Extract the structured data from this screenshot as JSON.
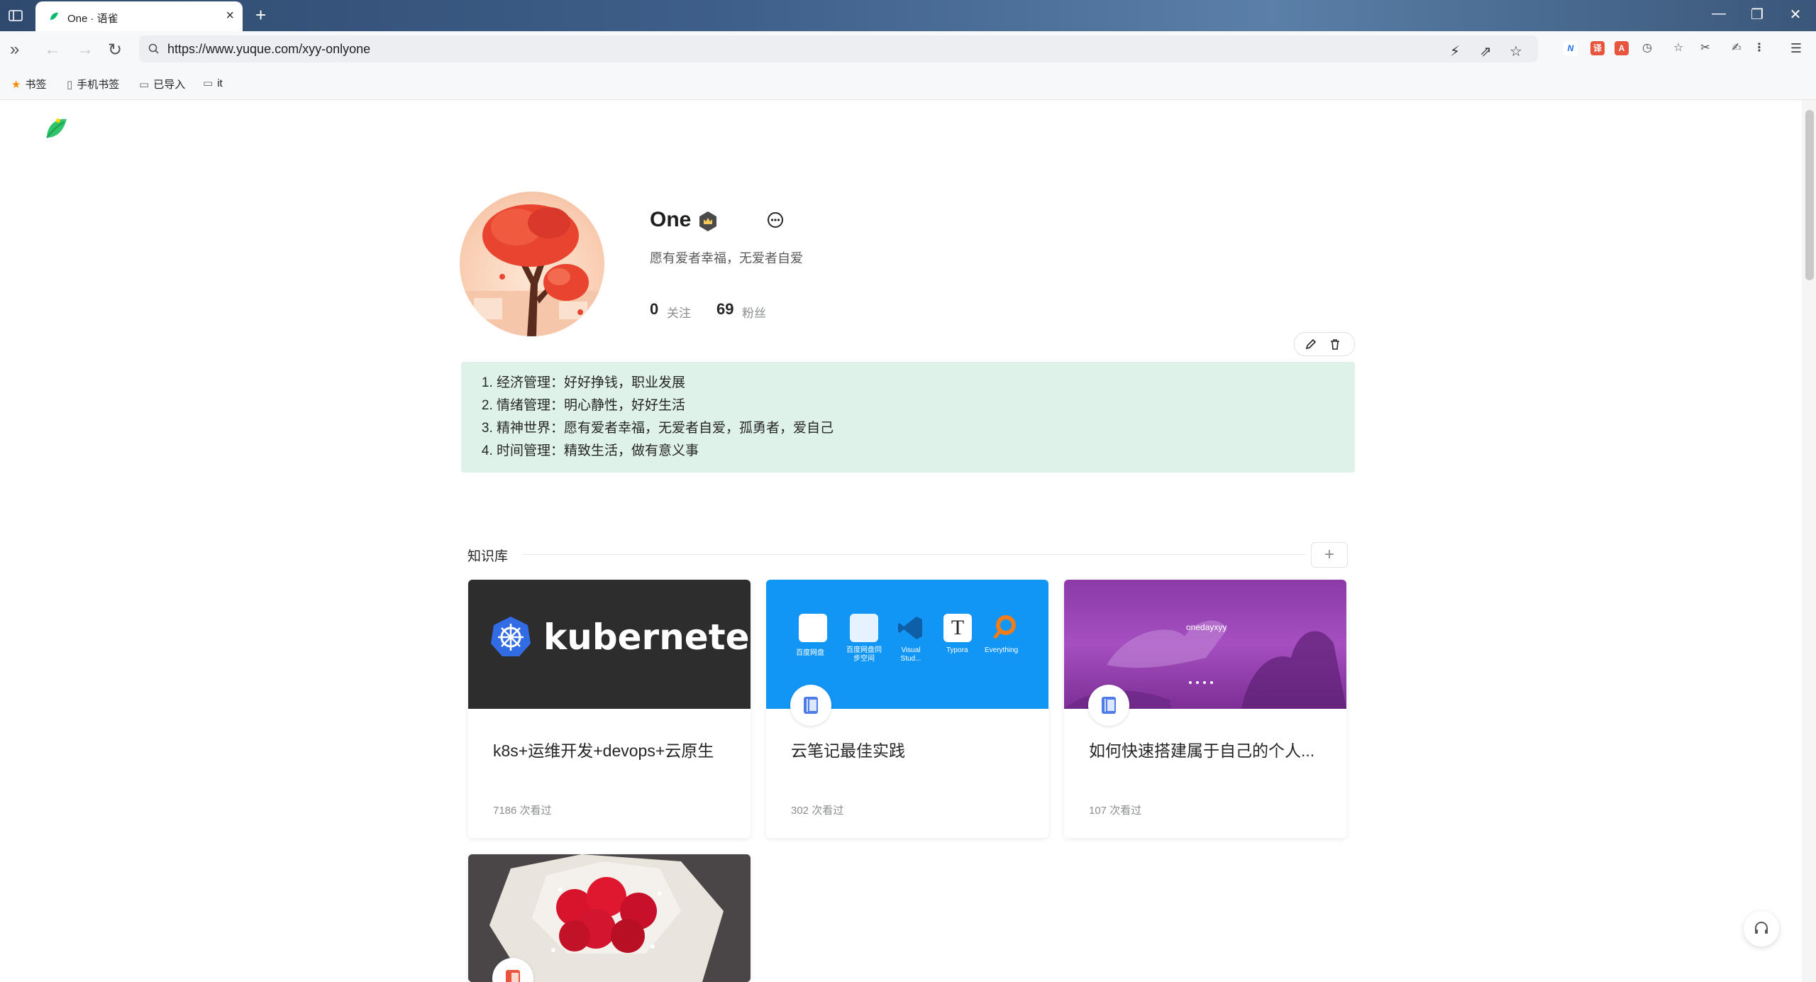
{
  "browser": {
    "tab_title": "One · 语雀",
    "tab_close": "×",
    "new_tab": "+",
    "url": "https://www.yuque.com/xyy-onlyone",
    "window_controls": {
      "minimize": "—",
      "restore": "❐",
      "close": "✕"
    },
    "bookmarks": [
      {
        "label": "书签",
        "icon": "star-icon"
      },
      {
        "label": "手机书签",
        "icon": "phone-icon"
      },
      {
        "label": "已导入",
        "icon": "folder-icon"
      },
      {
        "label": "it",
        "icon": "folder-icon"
      }
    ]
  },
  "profile": {
    "name": "One",
    "bio": "愿有爱者幸福，无爱者自爱",
    "following_count": "0",
    "following_label": "关注",
    "followers_count": "69",
    "followers_label": "粉丝"
  },
  "note": {
    "items": [
      "经济管理：好好挣钱，职业发展",
      "情绪管理：明心静性，好好生活",
      "精神世界：愿有爱者幸福，无爱者自爱，孤勇者，爱自己",
      "时间管理：精致生活，做有意义事"
    ]
  },
  "knowledge_base": {
    "section_title": "知识库",
    "add_label": "+",
    "cards": [
      {
        "title": "k8s+运维开发+devops+云原生",
        "views": "7186 次看过",
        "cover_text": "kubernetes"
      },
      {
        "title": "云笔记最佳实践",
        "views": "302 次看过",
        "cover_apps": [
          "百度网盘",
          "百度网盘同步空间",
          "Visual Stud...",
          "Typora",
          "Everything"
        ]
      },
      {
        "title": "如何快速搭建属于自己的个人...",
        "views": "107 次看过",
        "cover_text": "onedayxyy"
      },
      {
        "title": "",
        "views": ""
      }
    ]
  },
  "colors": {
    "accent": "#00b96b",
    "note_bg": "#dff2ea",
    "k8s_cover": "#2d2d2d",
    "cloud_cover": "#1296f5",
    "purple_cover": "#9a3fb6"
  }
}
